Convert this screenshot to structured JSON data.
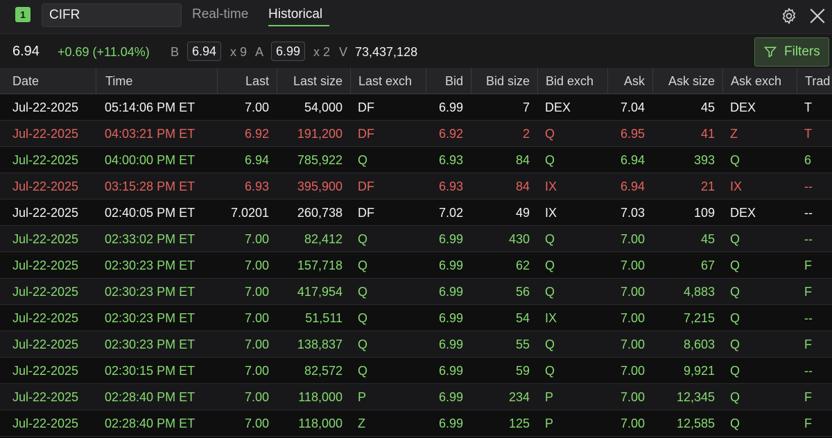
{
  "header": {
    "window_number": "1",
    "symbol": "CIFR",
    "tabs": [
      {
        "label": "Real-time",
        "active": false
      },
      {
        "label": "Historical",
        "active": true
      }
    ],
    "icons": [
      "settings-gear-icon",
      "close-icon"
    ]
  },
  "quote": {
    "last": "6.94",
    "change": "+0.69 (+11.04%)",
    "bid_label": "B",
    "bid": "6.94",
    "bid_size": "x 9",
    "ask_label": "A",
    "ask": "6.99",
    "ask_size": "x 2",
    "volume_label": "V",
    "volume": "73,437,128",
    "filters_label": "Filters"
  },
  "colors": {
    "up": "#86dc6f",
    "down": "#e5635d",
    "neutral": "#f4f4f4",
    "accent": "#6ecb63"
  },
  "table": {
    "columns": [
      "Date",
      "Time",
      "Last",
      "Last size",
      "Last exch",
      "Bid",
      "Bid size",
      "Bid exch",
      "Ask",
      "Ask size",
      "Ask exch",
      "Trad"
    ],
    "rows": [
      {
        "color": "white",
        "cells": [
          "Jul-22-2025",
          "05:14:06 PM ET",
          "7.00",
          "54,000",
          "DF",
          "6.99",
          "7",
          "DEX",
          "7.04",
          "45",
          "DEX",
          "T"
        ]
      },
      {
        "color": "red",
        "cells": [
          "Jul-22-2025",
          "04:03:21 PM ET",
          "6.92",
          "191,200",
          "DF",
          "6.92",
          "2",
          "Q",
          "6.95",
          "41",
          "Z",
          "T"
        ]
      },
      {
        "color": "green",
        "cells": [
          "Jul-22-2025",
          "04:00:00 PM ET",
          "6.94",
          "785,922",
          "Q",
          "6.93",
          "84",
          "Q",
          "6.94",
          "393",
          "Q",
          "6"
        ]
      },
      {
        "color": "red",
        "cells": [
          "Jul-22-2025",
          "03:15:28 PM ET",
          "6.93",
          "395,900",
          "DF",
          "6.93",
          "84",
          "IX",
          "6.94",
          "21",
          "IX",
          "--"
        ]
      },
      {
        "color": "white",
        "cells": [
          "Jul-22-2025",
          "02:40:05 PM ET",
          "7.0201",
          "260,738",
          "DF",
          "7.02",
          "49",
          "IX",
          "7.03",
          "109",
          "DEX",
          "--"
        ]
      },
      {
        "color": "green",
        "cells": [
          "Jul-22-2025",
          "02:33:02 PM ET",
          "7.00",
          "82,412",
          "Q",
          "6.99",
          "430",
          "Q",
          "7.00",
          "45",
          "Q",
          "--"
        ]
      },
      {
        "color": "green",
        "cells": [
          "Jul-22-2025",
          "02:30:23 PM ET",
          "7.00",
          "157,718",
          "Q",
          "6.99",
          "62",
          "Q",
          "7.00",
          "67",
          "Q",
          "F"
        ]
      },
      {
        "color": "green",
        "cells": [
          "Jul-22-2025",
          "02:30:23 PM ET",
          "7.00",
          "417,954",
          "Q",
          "6.99",
          "56",
          "Q",
          "7.00",
          "4,883",
          "Q",
          "F"
        ]
      },
      {
        "color": "green",
        "cells": [
          "Jul-22-2025",
          "02:30:23 PM ET",
          "7.00",
          "51,511",
          "Q",
          "6.99",
          "54",
          "IX",
          "7.00",
          "7,215",
          "Q",
          "--"
        ]
      },
      {
        "color": "green",
        "cells": [
          "Jul-22-2025",
          "02:30:23 PM ET",
          "7.00",
          "138,837",
          "Q",
          "6.99",
          "55",
          "Q",
          "7.00",
          "8,603",
          "Q",
          "F"
        ]
      },
      {
        "color": "green",
        "cells": [
          "Jul-22-2025",
          "02:30:15 PM ET",
          "7.00",
          "82,572",
          "Q",
          "6.99",
          "59",
          "Q",
          "7.00",
          "9,921",
          "Q",
          "--"
        ]
      },
      {
        "color": "green",
        "cells": [
          "Jul-22-2025",
          "02:28:40 PM ET",
          "7.00",
          "118,000",
          "P",
          "6.99",
          "234",
          "P",
          "7.00",
          "12,345",
          "Q",
          "F"
        ]
      },
      {
        "color": "green",
        "cells": [
          "Jul-22-2025",
          "02:28:40 PM ET",
          "7.00",
          "118,000",
          "Z",
          "6.99",
          "125",
          "P",
          "7.00",
          "12,585",
          "Q",
          "F"
        ]
      }
    ]
  }
}
